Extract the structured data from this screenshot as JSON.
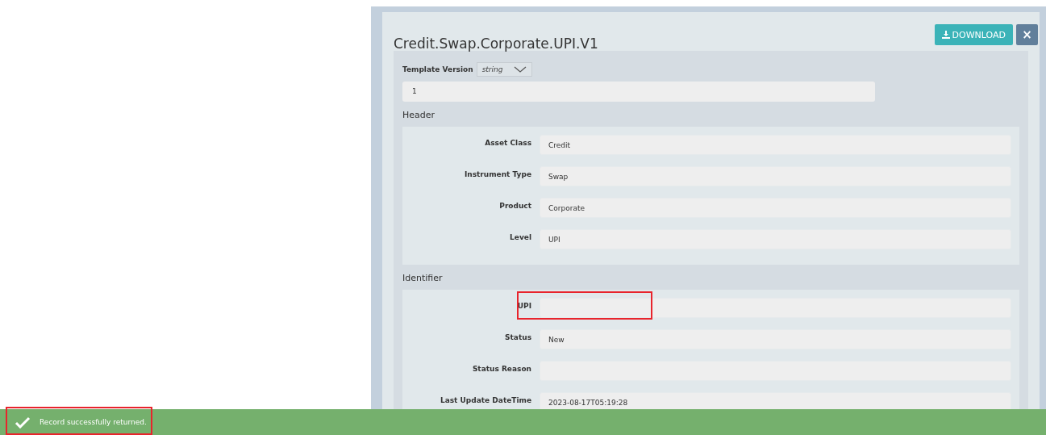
{
  "dialog": {
    "title": "Credit.Swap.Corporate.UPI.V1",
    "download_button": "DOWNLOAD",
    "close_button": "×"
  },
  "template_version": {
    "label": "Template Version",
    "type": "string",
    "value": "1"
  },
  "sections": [
    {
      "title": "Header",
      "fields": [
        {
          "label": "Asset Class",
          "value": "Credit",
          "highlighted": false
        },
        {
          "label": "Instrument Type",
          "value": "Swap",
          "highlighted": false
        },
        {
          "label": "Product",
          "value": "Corporate",
          "highlighted": false
        },
        {
          "label": "Level",
          "value": "UPI",
          "highlighted": false
        }
      ]
    },
    {
      "title": "Identifier",
      "fields": [
        {
          "label": "UPI",
          "highlighted": true
        },
        {
          "label": "Status",
          "value": "New",
          "highlighted": false
        },
        {
          "label": "Status Reason",
          "highlighted": false
        },
        {
          "label": "Last Update DateTime",
          "value": "2023-08-17T05:19:28",
          "highlighted": false
        }
      ]
    }
  ],
  "toast": {
    "message": "Record successfully returned.",
    "highlighted": true
  }
}
